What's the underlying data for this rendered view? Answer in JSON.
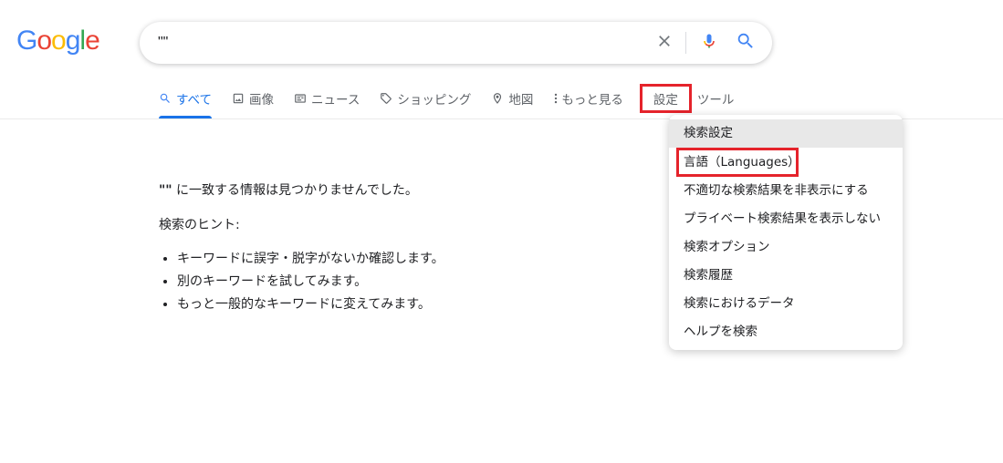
{
  "logo": {
    "letters": [
      "G",
      "o",
      "o",
      "g",
      "l",
      "e"
    ],
    "colors": [
      "#4285F4",
      "#EA4335",
      "#FBBC05",
      "#4285F4",
      "#34A853",
      "#EA4335"
    ]
  },
  "search": {
    "value": "\"\"",
    "clear_icon": "close-icon",
    "mic_icon": "mic-icon",
    "search_icon": "search-icon"
  },
  "tabs": [
    {
      "label": "すべて",
      "icon": "search-icon",
      "active": true
    },
    {
      "label": "画像",
      "icon": "image-icon"
    },
    {
      "label": "ニュース",
      "icon": "news-icon"
    },
    {
      "label": "ショッピング",
      "icon": "tag-icon"
    },
    {
      "label": "地図",
      "icon": "map-pin-icon"
    },
    {
      "label": "もっと見る",
      "icon": "more-vert-icon"
    },
    {
      "label": "設定"
    },
    {
      "label": "ツール"
    }
  ],
  "results": {
    "query": "\"\"",
    "no_result_text": " に一致する情報は見つかりませんでした。",
    "hint_title": "検索のヒント:",
    "hints": [
      "キーワードに誤字・脱字がないか確認します。",
      "別のキーワードを試してみます。",
      "もっと一般的なキーワードに変えてみます。"
    ]
  },
  "settings_menu": {
    "items": [
      "検索設定",
      "言語（Languages）",
      "不適切な検索結果を非表示にする",
      "プライベート検索結果を表示しない",
      "検索オプション",
      "検索履歴",
      "検索におけるデータ",
      "ヘルプを検索"
    ]
  },
  "colors": {
    "accent": "#1a73e8",
    "highlight_border": "#e5232b",
    "tab_text": "#5f6368"
  }
}
